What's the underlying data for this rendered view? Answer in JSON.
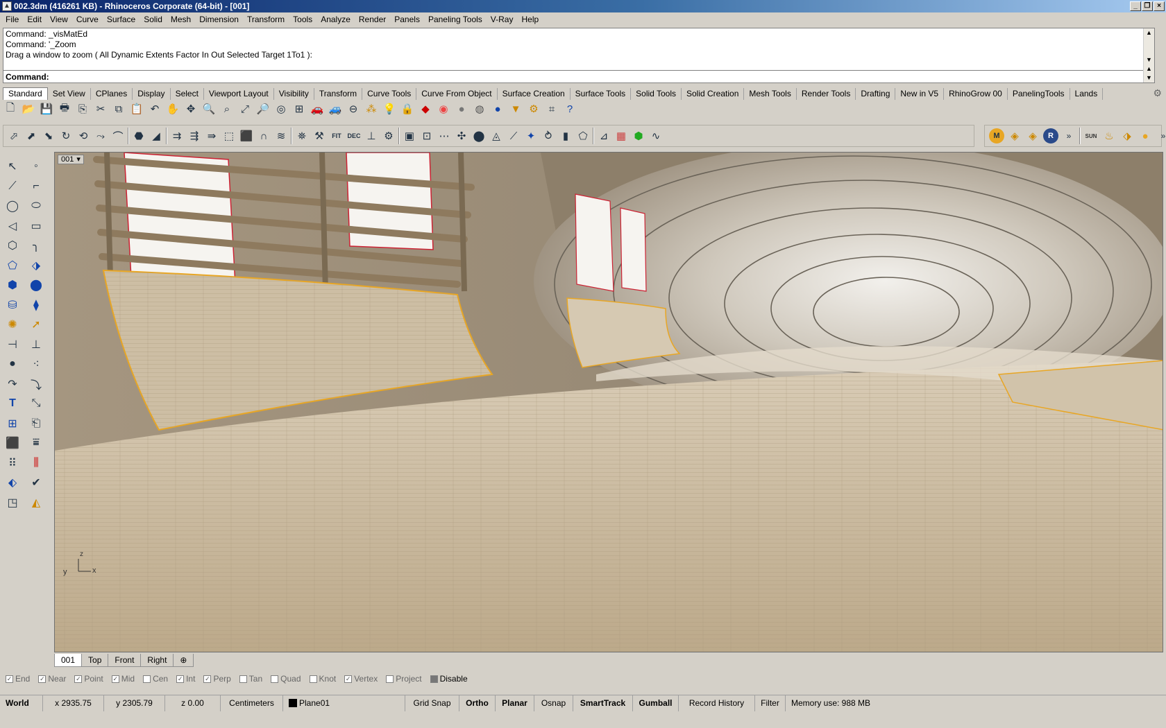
{
  "window": {
    "title": "002.3dm (416261 KB) - Rhinoceros Corporate (64-bit) - [001]",
    "min": "_",
    "restore": "❐",
    "close": "×"
  },
  "menu": [
    "File",
    "Edit",
    "View",
    "Curve",
    "Surface",
    "Solid",
    "Mesh",
    "Dimension",
    "Transform",
    "Tools",
    "Analyze",
    "Render",
    "Panels",
    "Paneling Tools",
    "V-Ray",
    "Help"
  ],
  "command": {
    "history": [
      "Command: _visMatEd",
      "Command: '_Zoom",
      "Drag a window to zoom ( All  Dynamic  Extents  Factor  In  Out  Selected  Target  1To1 ):"
    ],
    "prompt": "Command:"
  },
  "toolbar_tabs": [
    "Standard",
    "Set View",
    "CPlanes",
    "Display",
    "Select",
    "Viewport Layout",
    "Visibility",
    "Transform",
    "Curve Tools",
    "Curve From Object",
    "Surface Creation",
    "Surface Tools",
    "Solid Tools",
    "Solid Creation",
    "Mesh Tools",
    "Render Tools",
    "Drafting",
    "New in V5",
    "RhinoGrow 00",
    "PanelingTools",
    "Lands"
  ],
  "toolbar_row1_icons": [
    "new-file-icon",
    "open-file-icon",
    "save-icon",
    "print-icon",
    "import-icon",
    "cut-icon",
    "copy-icon",
    "paste-icon",
    "undo-icon",
    "pan-hand-icon",
    "move-view-icon",
    "zoom-icon",
    "zoom-window-icon",
    "zoom-extents-icon",
    "zoom-selected-icon",
    "zoom-target-icon",
    "viewport-grid-icon",
    "car-icon",
    "car-outline-icon",
    "snap-icon",
    "object-snap-icon",
    "light-bulb-icon",
    "lock-icon",
    "material-icon",
    "color-wheel-icon",
    "sphere-icon",
    "shaded-sphere-icon",
    "render-sphere-icon",
    "lamp-icon",
    "settings-icon",
    "cplane-icon",
    "help-icon"
  ],
  "toolbar_row2_icons": [
    "extrude-icon",
    "loft-icon",
    "sweep-icon",
    "revolve-icon",
    "rail-revolve-icon",
    "blend-icon",
    "patch-icon",
    "network-icon",
    "fillet-surface-icon",
    "offset-surface-icon",
    "extend-icon",
    "split-icon",
    "trim-icon",
    "box-icon",
    "pipe-icon",
    "shell-icon",
    "union-icon",
    "difference-icon",
    "fit-icon",
    "dec-icon",
    "explode-icon",
    "join-icon",
    "scale-icon",
    "rotate-icon",
    "cap-icon",
    "cylinder-icon",
    "sphere-solid-icon",
    "array-icon",
    "mirror-icon",
    "orient-icon",
    "flow-icon",
    "twist-icon",
    "bend-icon",
    "taper-icon",
    "analysis-icon",
    "zebra-icon",
    "curvature-icon"
  ],
  "toolbar_row2_labels": {
    "fit": "FIT",
    "dec": "DEC"
  },
  "toolbar_row3": {
    "labels": {
      "sun": "SUN"
    },
    "vray_letters": [
      "M",
      "R"
    ]
  },
  "left_toolbar_icons": [
    "select-arrow-icon",
    "point-icon",
    "polyline-icon",
    "control-point-icon",
    "circle-icon",
    "ellipse-icon",
    "arc-icon",
    "rectangle-icon",
    "polygon-icon",
    "fillet-curve-icon",
    "surface-corner-icon",
    "surface-edge-icon",
    "solid-box-icon",
    "solid-boolean-icon",
    "extrude-curve-icon",
    "edit-surface-icon",
    "light-icon",
    "arrow-transform-icon",
    "dimension-icon",
    "align-icon",
    "group-icon",
    "points-grid-icon",
    "curve-tool-icon",
    "rebuild-curve-icon",
    "text-icon",
    "move-points-icon",
    "block-icon",
    "paste-special-icon",
    "mesh-box-icon",
    "history-icon",
    "array-grid-icon",
    "tolerance-icon",
    "analyze-icon",
    "check-icon",
    "render-cube-icon",
    "paint-icon"
  ],
  "viewport": {
    "name": "001",
    "axes": {
      "z": "z",
      "y": "y",
      "x": "x"
    }
  },
  "viewport_tabs": [
    "001",
    "Top",
    "Front",
    "Right",
    "⊕"
  ],
  "osnaps": [
    {
      "label": "End",
      "checked": true
    },
    {
      "label": "Near",
      "checked": true
    },
    {
      "label": "Point",
      "checked": true
    },
    {
      "label": "Mid",
      "checked": true
    },
    {
      "label": "Cen",
      "checked": false
    },
    {
      "label": "Int",
      "checked": true
    },
    {
      "label": "Perp",
      "checked": true
    },
    {
      "label": "Tan",
      "checked": false
    },
    {
      "label": "Quad",
      "checked": false
    },
    {
      "label": "Knot",
      "checked": false
    },
    {
      "label": "Vertex",
      "checked": true
    },
    {
      "label": "Project",
      "checked": false
    },
    {
      "label": "Disable",
      "checked": true
    }
  ],
  "status": {
    "cplane": "World",
    "x": "x 2935.75",
    "y": "y 2305.79",
    "z": "z 0.00",
    "units": "Centimeters",
    "layer": "Plane01",
    "gridsnap": "Grid Snap",
    "ortho": "Ortho",
    "planar": "Planar",
    "osnap": "Osnap",
    "smarttrack": "SmartTrack",
    "gumball": "Gumball",
    "record": "Record History",
    "filter": "Filter",
    "memory": "Memory use: 988 MB"
  },
  "colors": {
    "titlebar": "#0a246a",
    "accent_orange": "#e8a624",
    "wood_floor": "#c9b89a",
    "chrome": "#d4d0c8"
  }
}
